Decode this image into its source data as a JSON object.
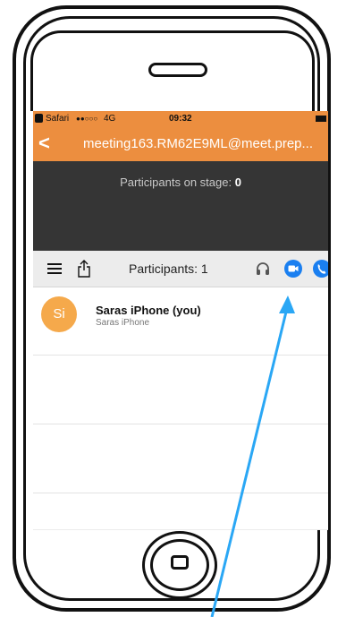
{
  "status_bar": {
    "carrier": "Safari",
    "signal": "●●○○○",
    "network": "4G",
    "time": "09:32"
  },
  "header": {
    "back_label": "<",
    "title": "meeting163.RM62E9ML@meet.prep..."
  },
  "stage": {
    "label": "Participants on stage: ",
    "count": "0"
  },
  "toolbar": {
    "menu_icon": "hamburger-menu-icon",
    "share_icon": "share-icon",
    "participants_label": "Participants: 1",
    "headphones_icon": "headphones-icon",
    "video_icon": "video-camera-icon",
    "phone_icon": "phone-icon"
  },
  "participants": [
    {
      "initials": "Si",
      "name": "Saras iPhone (you)",
      "device": "Saras iPhone"
    }
  ],
  "colors": {
    "header": "#ec8e3f",
    "stage": "#353535",
    "avatar": "#f5a94b",
    "accent_blue": "#1a7ff0",
    "arrow": "#2aa7f5"
  }
}
